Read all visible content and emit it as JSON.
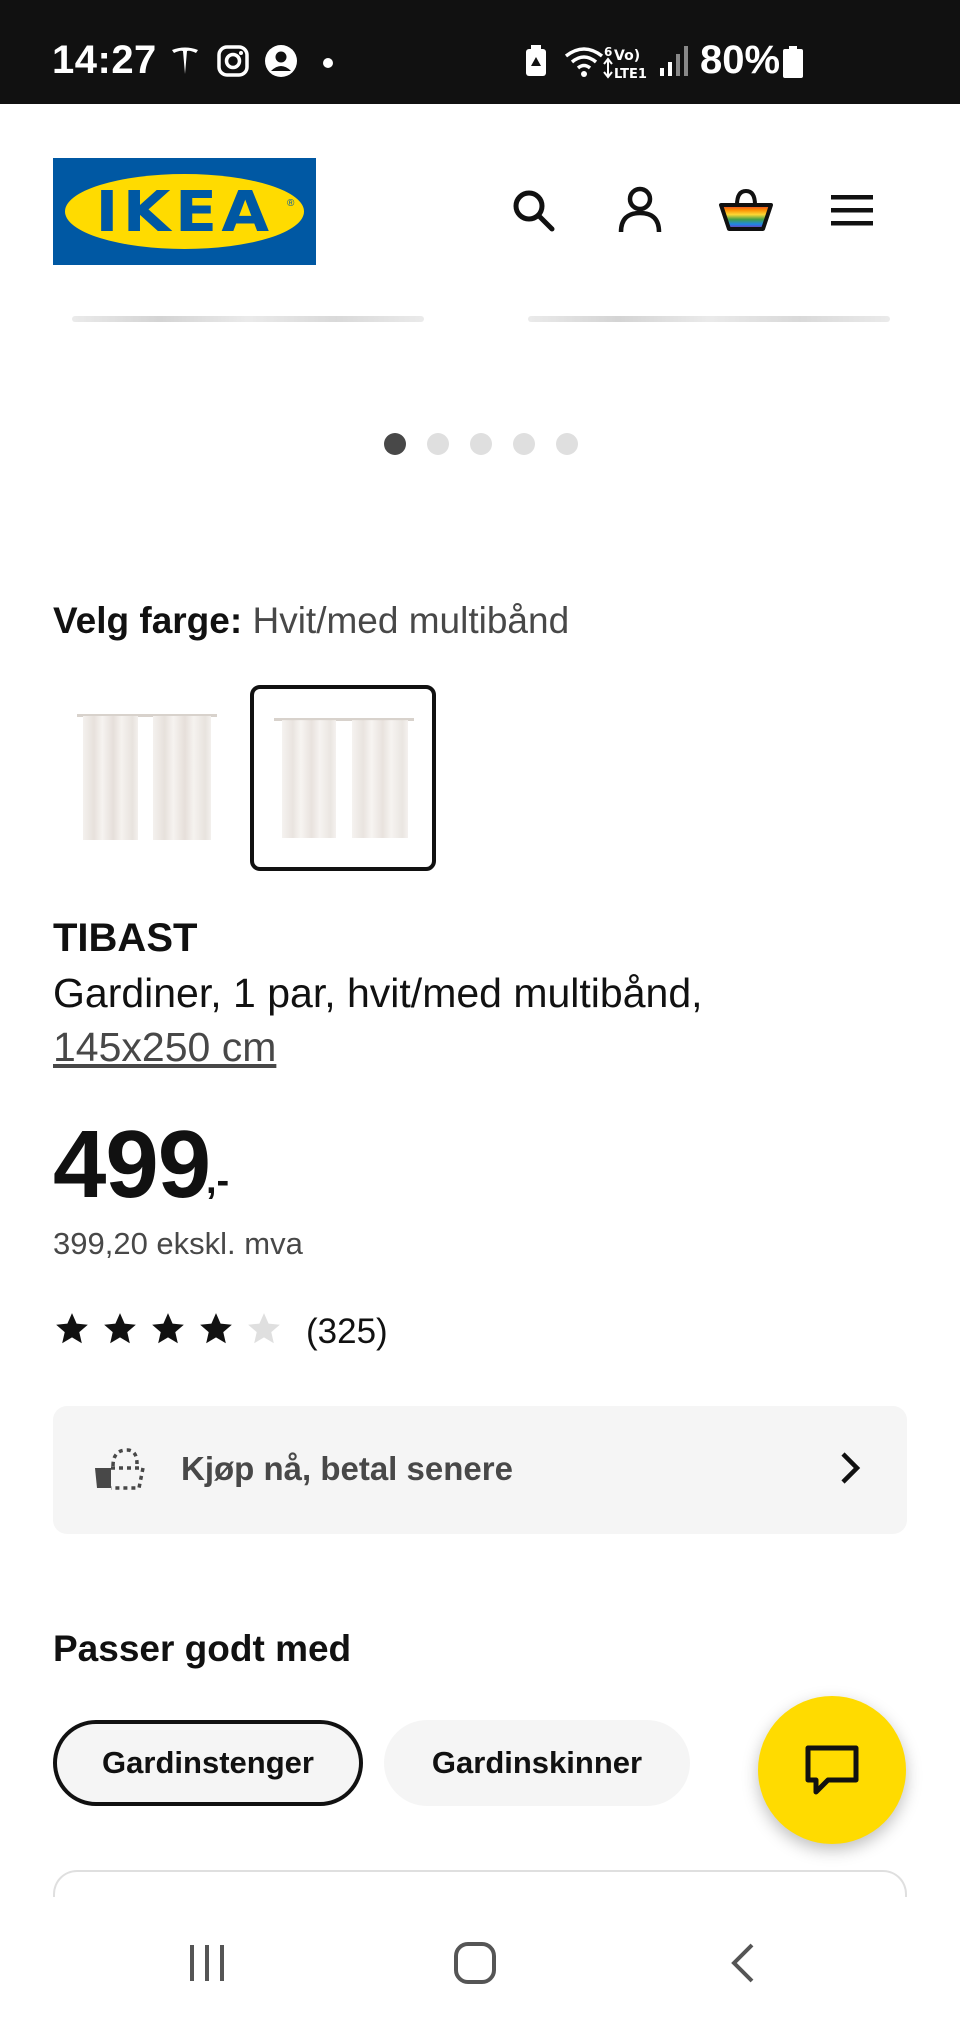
{
  "status_bar": {
    "time": "14:27",
    "battery": "80%",
    "icons": [
      "tesla-icon",
      "instagram-icon",
      "account-circle-icon",
      "dot-icon",
      "battery-saver-icon",
      "wifi-6-icon",
      "volte-lte1-icon",
      "signal-icon",
      "battery-icon"
    ]
  },
  "header": {
    "logo_text": "IKEA",
    "icons": [
      "search-icon",
      "account-icon",
      "basket-icon",
      "menu-icon"
    ]
  },
  "carousel": {
    "dot_count": 5,
    "active_index": 0
  },
  "color_picker": {
    "label": "Velg farge:",
    "value": "Hvit/med multibånd",
    "selected_index": 1
  },
  "product": {
    "name": "TIBAST",
    "description": "Gardiner, 1 par, hvit/med multibånd,",
    "size": "145x250 cm",
    "price": "499",
    "price_suffix": ",-",
    "price_ex_vat": "399,20 ekskl. mva",
    "rating": 4,
    "rating_max": 5,
    "review_count": "(325)"
  },
  "bnpl": {
    "label": "Kjøp nå, betal senere"
  },
  "goes_well_with": {
    "title": "Passer godt med",
    "pills": [
      "Gardinstenger",
      "Gardinskinner"
    ],
    "active_index": 0
  },
  "colors": {
    "ikea_blue": "#0058a3",
    "ikea_yellow": "#ffdb00"
  }
}
